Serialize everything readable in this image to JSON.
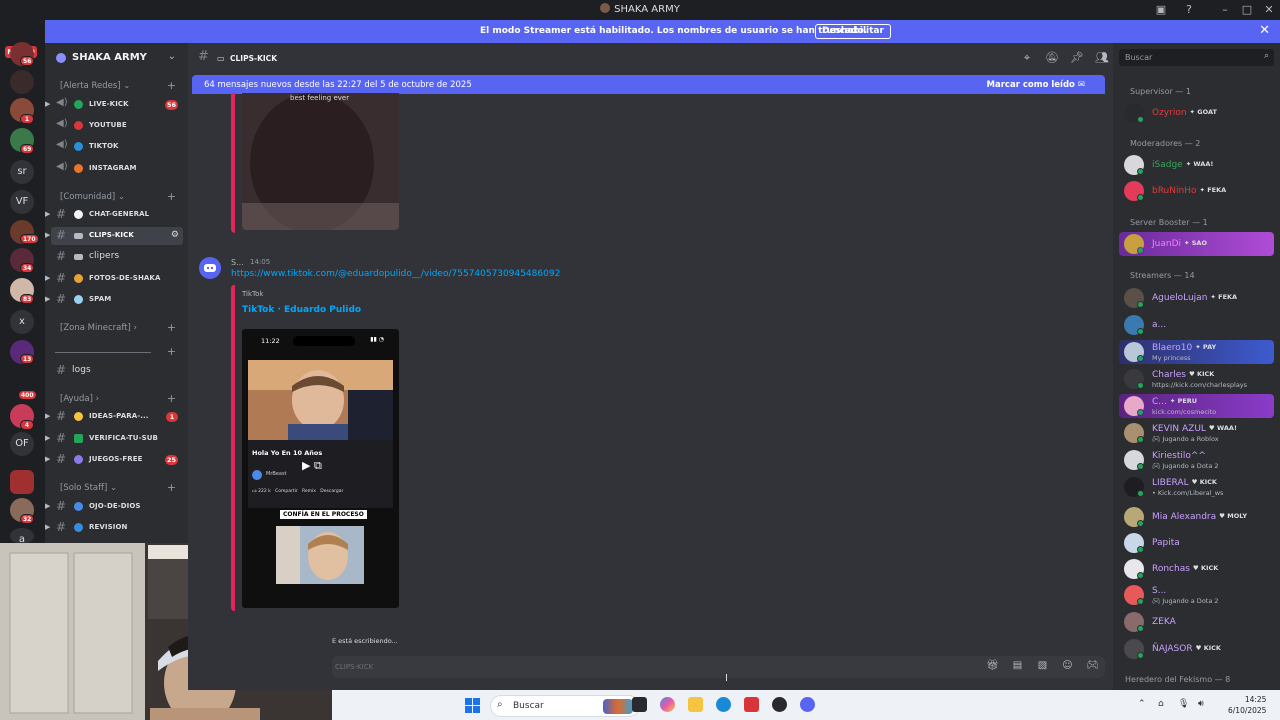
{
  "window": {
    "title": "SHAKA ARMY"
  },
  "streamer_bar": {
    "message": "El modo Streamer está habilitado. Los nombres de usuario se han truncado.",
    "disable_label": "Deshabilitar"
  },
  "guilds": {
    "new_label": "NUEVO",
    "badges": [
      "56",
      "1",
      "69",
      "170",
      "34",
      "83",
      "13",
      "400",
      "4",
      "32"
    ],
    "text_icons": [
      "sr",
      "VF",
      "x",
      "OF",
      "a"
    ]
  },
  "server": {
    "name": "SHAKA ARMY"
  },
  "categories": {
    "alerta": "[Alerta Redes]",
    "comunidad": "[Comunidad]",
    "minecraft": "[Zona Minecraft]",
    "ayuda": "[Ayuda]",
    "staff": "[Solo Staff]"
  },
  "channels": {
    "live_kick": {
      "label": "LIVE-KICK",
      "badge": "56"
    },
    "youtube": {
      "label": "YOUTUBE"
    },
    "tiktok": {
      "label": "TIKTOK"
    },
    "instagram": {
      "label": "INSTAGRAM"
    },
    "chat_general": {
      "label": "CHAT-GENERAL"
    },
    "clips_kick": {
      "label": "CLIPS-KICK"
    },
    "clipers": {
      "label": "clipers"
    },
    "fotos": {
      "label": "FOTOS-DE-SHAKA"
    },
    "spam": {
      "label": "SPAM"
    },
    "logs": {
      "label": "logs"
    },
    "ideas": {
      "label": "IDEAS-PARA-...",
      "badge": "1"
    },
    "verifica": {
      "label": "VERIFICA-TU-SUB"
    },
    "juegos": {
      "label": "JUEGOS-FREE",
      "badge": "25"
    },
    "ojo": {
      "label": "OJO-DE-DIOS"
    },
    "revision": {
      "label": "REVISION"
    }
  },
  "chat_header": {
    "channel": "CLIPS-KICK"
  },
  "new_messages_bar": {
    "text": "64 mensajes nuevos desde las 22:27 del 5 de octubre de 2025",
    "mark_read": "Marcar como leído"
  },
  "messages": {
    "embed1_caption": "best feeling ever",
    "msg2": {
      "user": "S...",
      "time": "14:05",
      "link": "https://www.tiktok.com/@eduardopulido__/video/7557405730945486092"
    },
    "embed2": {
      "provider": "TikTok",
      "title": "TikTok · Eduardo Pulido",
      "phone_time": "11:22",
      "video_title": "Hola Yo En 10 Años",
      "channel": "MrBeast",
      "likes": "222 k",
      "action_share": "Compartir",
      "action_remix": "Remix",
      "action_download": "Descargar",
      "overlay": "CONFÍA EN EL PROCESO"
    }
  },
  "typing": "E está escribiendo...",
  "composer": {
    "placeholder": "CLIPS-KICK"
  },
  "members": {
    "search_placeholder": "Buscar",
    "groups": [
      {
        "title": "Supervisor — 1",
        "items": [
          {
            "name": "Ozyrion",
            "tag": "GOAT",
            "color": "#e23c3c"
          }
        ]
      },
      {
        "title": "Moderadores — 2",
        "items": [
          {
            "name": "iSadge",
            "tag": "WAA!",
            "color": "#3ba55c"
          },
          {
            "name": "bRuNinHo",
            "tag": "FEKA",
            "color": "#e23c3c"
          }
        ]
      },
      {
        "title": "Server Booster — 1",
        "items": [
          {
            "name": "JuanDi",
            "tag": "SAO",
            "color": "#f47fff"
          }
        ]
      },
      {
        "title": "Streamers — 14",
        "items": [
          {
            "name": "AgueloLujan",
            "tag": "FEKA",
            "color": "#c9a0ff"
          },
          {
            "name": "a...",
            "tag": "",
            "color": "#c9a0ff"
          },
          {
            "name": "Blaero10",
            "tag": "PAY",
            "sub": "My princess",
            "color": "#c9a0ff"
          },
          {
            "name": "Charles",
            "tag": "KICK",
            "sub": "https://kick.com/charlesplays",
            "color": "#c9a0ff"
          },
          {
            "name": "C...",
            "tag": "PERU",
            "sub": "kick.com/cosmecito",
            "color": "#c9a0ff"
          },
          {
            "name": "KEVIN AZUL",
            "tag": "WAA!",
            "sub": "Jugando a Roblox",
            "color": "#c9a0ff"
          },
          {
            "name": "Kiriestilo^^",
            "tag": "",
            "sub": "Jugando a Dota 2",
            "color": "#c9a0ff"
          },
          {
            "name": "LIBERAL",
            "tag": "KICK",
            "sub": "• Kick.com/Liberal_ws",
            "color": "#c9a0ff"
          },
          {
            "name": "Mia Alexandra",
            "tag": "MOLY",
            "color": "#c9a0ff"
          },
          {
            "name": "Papita",
            "tag": "",
            "color": "#c9a0ff"
          },
          {
            "name": "Ronchas",
            "tag": "KICK",
            "color": "#c9a0ff"
          },
          {
            "name": "S...",
            "tag": "",
            "sub": "Jugando a Dota 2",
            "color": "#c9a0ff"
          },
          {
            "name": "ZEKA",
            "tag": "",
            "color": "#c9a0ff"
          },
          {
            "name": "ÑAJASOR",
            "tag": "KICK",
            "color": "#c9a0ff"
          }
        ]
      },
      {
        "title": "Heredero del Fekismo — 8",
        "items": []
      }
    ]
  },
  "taskbar": {
    "search_placeholder": "Buscar",
    "time": "14:25",
    "date": "6/10/2025"
  }
}
